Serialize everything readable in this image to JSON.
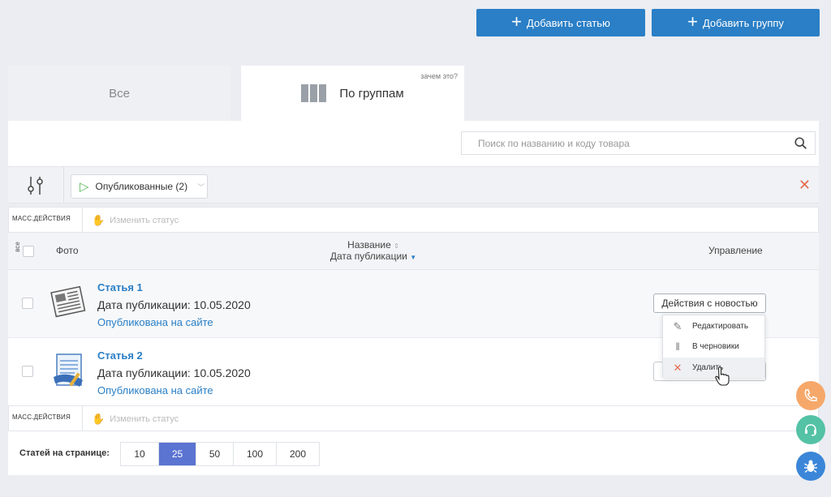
{
  "top_buttons": {
    "add_article": "Добавить статью",
    "add_group": "Добавить группу"
  },
  "tabs": {
    "all": "Все",
    "by_groups": "По группам",
    "why": "зачем это?"
  },
  "search": {
    "placeholder": "Поиск по названию и коду товара"
  },
  "filter": {
    "status_label": "Опубликованные (2)"
  },
  "mass_actions": {
    "label": "МАСС.ДЕЙСТВИЯ",
    "change_status": "Изменить статус"
  },
  "table": {
    "all_label": "все",
    "col_photo": "Фото",
    "col_name": "Название",
    "col_date": "Дата публикации",
    "col_manage": "Управление"
  },
  "rows": [
    {
      "title": "Статья 1",
      "date": "Дата публикации: 10.05.2020",
      "status": "Опубликована на сайте",
      "thumb": "newspaper-icon"
    },
    {
      "title": "Статья 2",
      "date": "Дата публикации: 10.05.2020",
      "status": "Опубликована на сайте",
      "thumb": "document-edit-icon"
    }
  ],
  "actions": {
    "button_label": "Действия с новостью",
    "menu": {
      "edit": "Редактировать",
      "to_draft": "В черновики",
      "delete": "Удалить"
    }
  },
  "pager": {
    "label": "Статей на странице:",
    "options": [
      "10",
      "25",
      "50",
      "100",
      "200"
    ],
    "selected": "25"
  },
  "colors": {
    "primary": "#2a7fc6",
    "pager_active": "#5b73d1",
    "close": "#e56b4e",
    "phone": "#f6a86a",
    "support": "#54c2a5",
    "bug": "#3b86d8"
  }
}
